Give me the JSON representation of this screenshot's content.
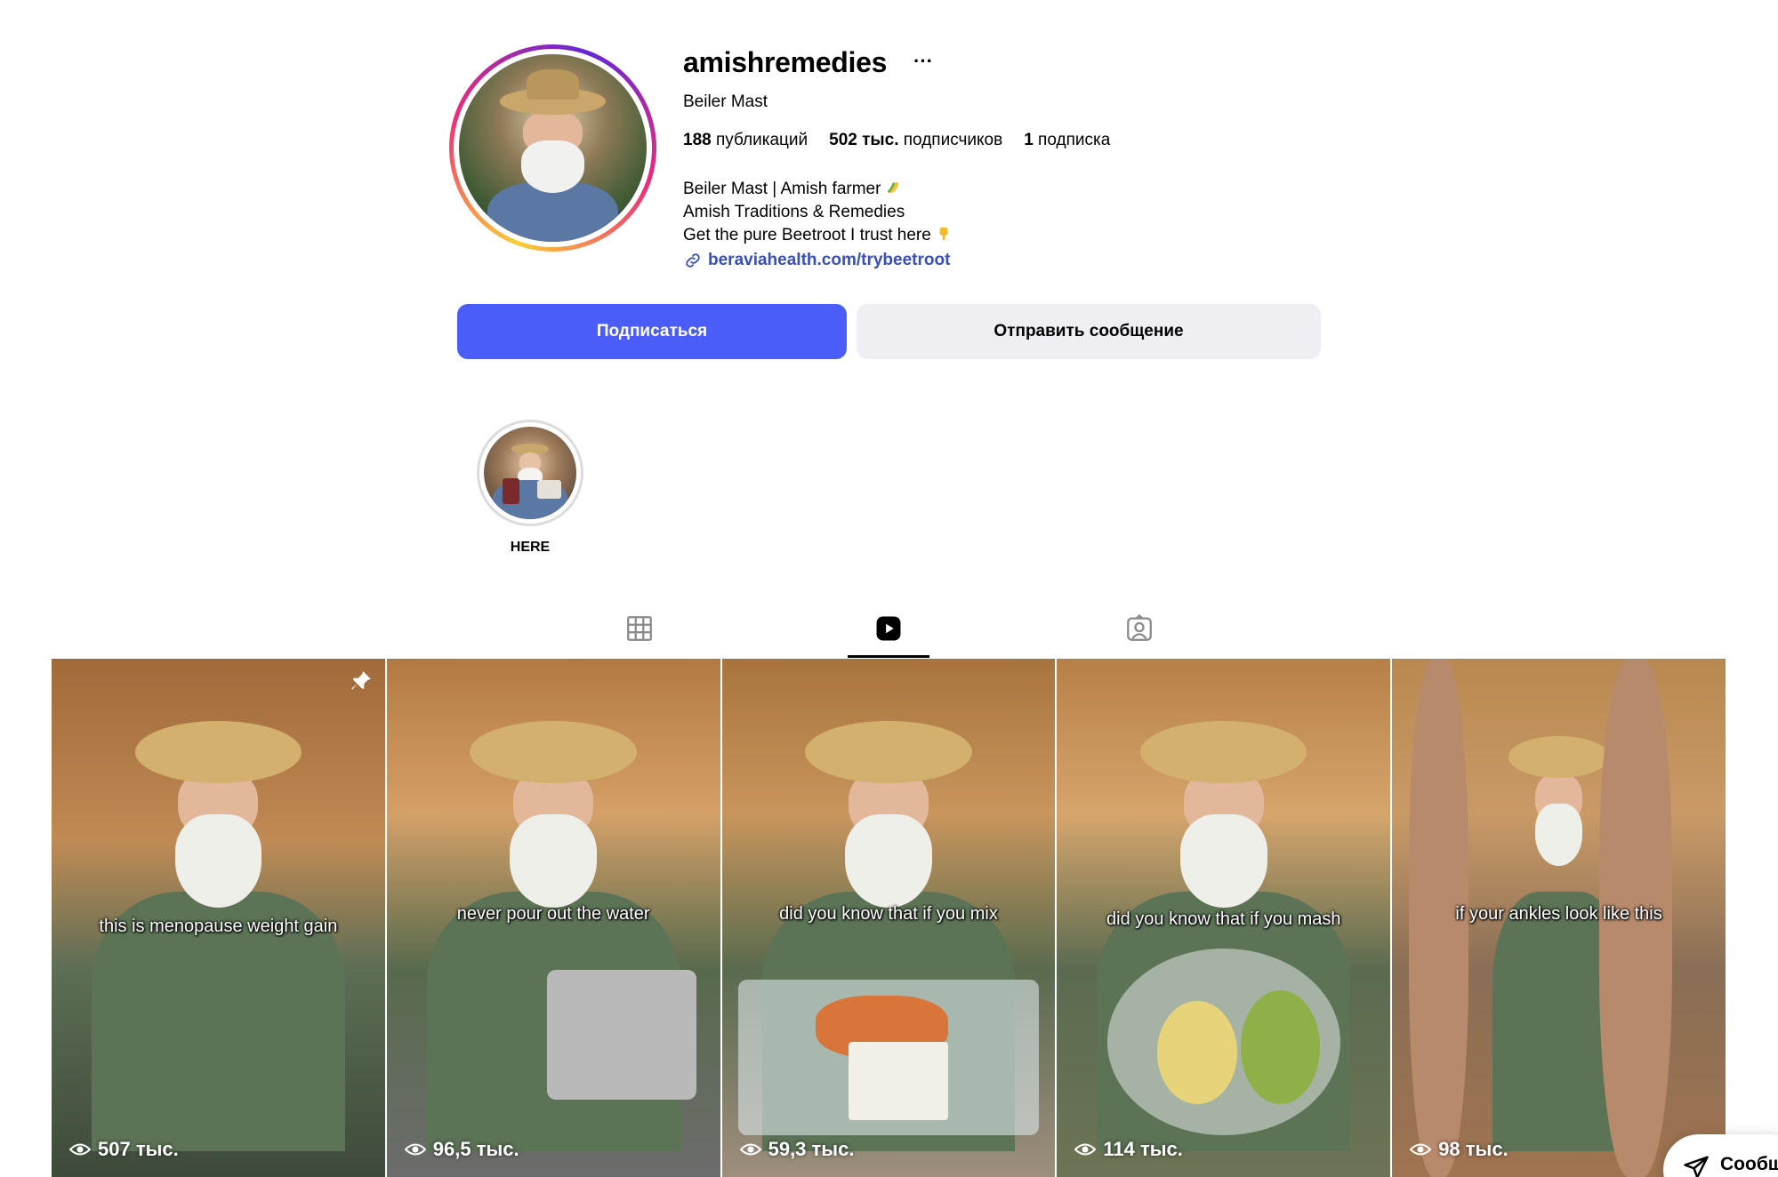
{
  "profile": {
    "username": "amishremedies",
    "more": "···",
    "full_name": "Beiler Mast",
    "stats": {
      "posts_count": "188",
      "posts_label": "публикаций",
      "followers_count": "502 тыс.",
      "followers_label": "подписчиков",
      "following_count": "1",
      "following_label": "подписка"
    },
    "bio": {
      "line1": "Beiler Mast | Amish farmer",
      "line1_emoji": "corn-emoji",
      "line2": "Amish Traditions & Remedies",
      "line3": "Get the pure Beetroot I trust here",
      "line3_emoji": "pointing-down-emoji"
    },
    "link": "beraviahealth.com/trybeetroot"
  },
  "actions": {
    "follow_label": "Подписаться",
    "message_label": "Отправить сообщение"
  },
  "highlights": [
    {
      "label": "HERE"
    }
  ],
  "tabs": [
    {
      "icon": "grid-icon",
      "active": false
    },
    {
      "icon": "reels-icon",
      "active": true
    },
    {
      "icon": "tagged-icon",
      "active": false
    }
  ],
  "reels": [
    {
      "caption": "this is menopause weight gain",
      "views": "507 тыс.",
      "pinned": true
    },
    {
      "caption": "never pour out the water",
      "views": "96,5 тыс.",
      "pinned": false
    },
    {
      "caption": "did you know that if you mix",
      "views": "59,3 тыс.",
      "pinned": false
    },
    {
      "caption": "did you know that if you mash",
      "views": "114 тыс.",
      "pinned": false
    },
    {
      "caption": "if your ankles look like this",
      "views": "98 тыс.",
      "pinned": false
    }
  ],
  "messages_bubble": {
    "label": "Сообщ"
  },
  "colors": {
    "follow_button": "#4a5df9",
    "message_button": "#efeff3",
    "link": "#3a4fb5"
  }
}
